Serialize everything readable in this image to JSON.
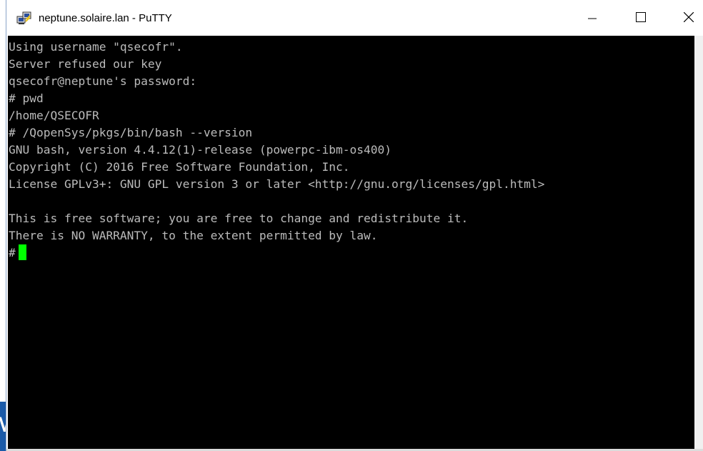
{
  "window": {
    "title": "neptune.solaire.lan - PuTTY",
    "icons": {
      "app": "putty-computers-icon",
      "minimize": "minimize-icon",
      "maximize": "maximize-icon",
      "close": "close-icon"
    }
  },
  "terminal": {
    "lines": [
      "Using username \"qsecofr\".",
      "Server refused our key",
      "qsecofr@neptune's password:",
      "# pwd",
      "/home/QSECOFR",
      "# /QopenSys/pkgs/bin/bash --version",
      "GNU bash, version 4.4.12(1)-release (powerpc-ibm-os400)",
      "Copyright (C) 2016 Free Software Foundation, Inc.",
      "License GPLv3+: GNU GPL version 3 or later <http://gnu.org/licenses/gpl.html>",
      "",
      "This is free software; you are free to change and redistribute it.",
      "There is NO WARRANTY, to the extent permitted by law."
    ],
    "prompt": "#",
    "colors": {
      "background": "#000000",
      "foreground": "#bbbbbb",
      "cursor": "#00ff00"
    }
  },
  "desktop": {
    "edge_text": "M",
    "edge_color": "#1a5aa8"
  }
}
